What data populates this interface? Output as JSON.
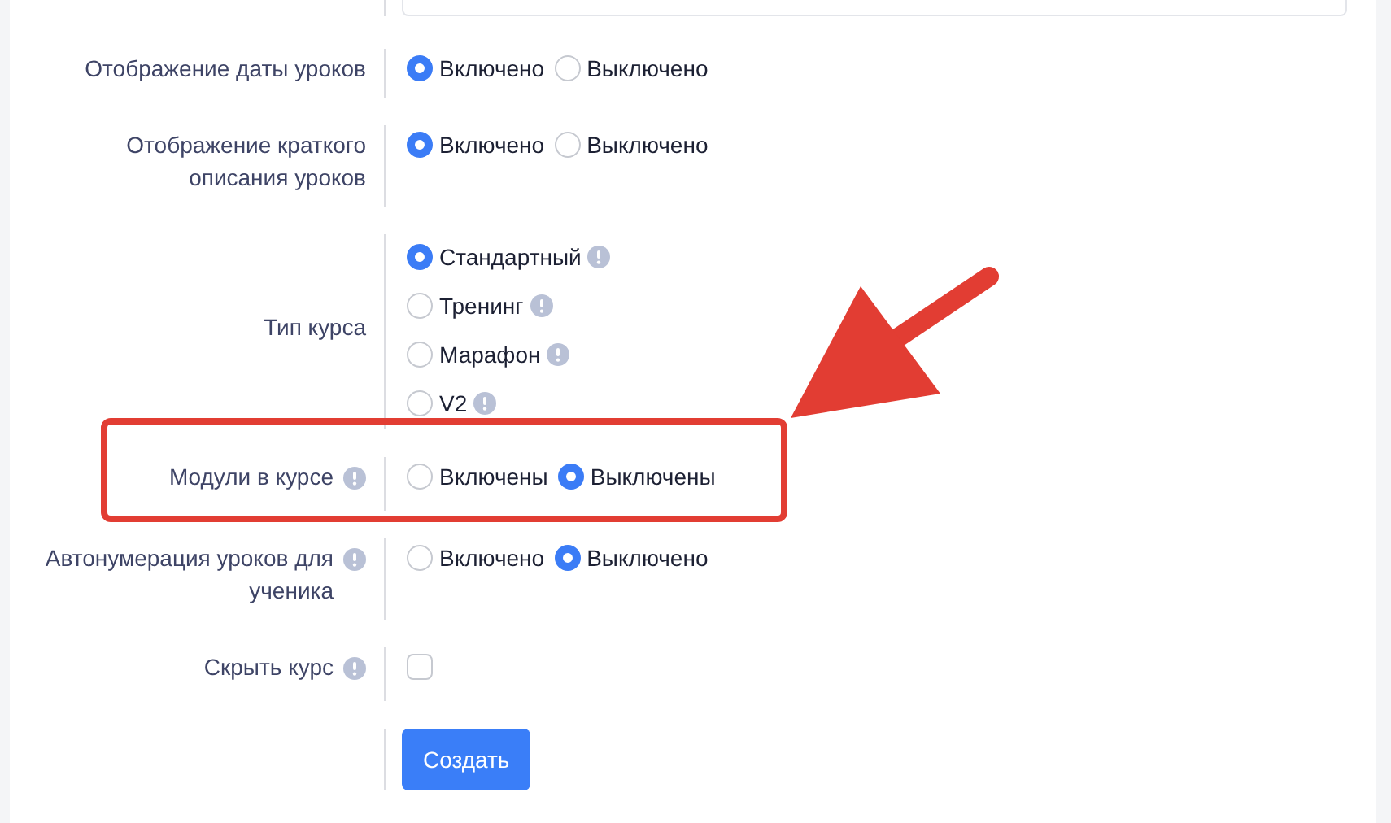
{
  "annotation": {
    "arrow": true
  },
  "rows": [
    {
      "kind": "field"
    },
    {
      "kind": "radio-inline",
      "label": "Отображение даты уроков",
      "hint": false,
      "options": [
        {
          "label": "Включено",
          "selected": true
        },
        {
          "label": "Выключено",
          "selected": false
        }
      ]
    },
    {
      "kind": "radio-inline",
      "label": "Отображение краткого описания уроков",
      "hint": false,
      "options": [
        {
          "label": "Включено",
          "selected": true
        },
        {
          "label": "Выключено",
          "selected": false
        }
      ]
    },
    {
      "kind": "radio-stacked",
      "label": "Тип курса",
      "hint": false,
      "options": [
        {
          "label": "Стандартный",
          "selected": true,
          "hint": true
        },
        {
          "label": "Тренинг",
          "selected": false,
          "hint": true
        },
        {
          "label": "Марафон",
          "selected": false,
          "hint": true
        },
        {
          "label": "V2",
          "selected": false,
          "hint": true
        }
      ]
    },
    {
      "kind": "radio-inline",
      "label": "Модули в курсе",
      "hint": true,
      "highlighted": true,
      "options": [
        {
          "label": "Включены",
          "selected": false
        },
        {
          "label": "Выключены",
          "selected": true
        }
      ]
    },
    {
      "kind": "radio-inline",
      "label": "Автонумерация уроков для ученика",
      "hint": true,
      "options": [
        {
          "label": "Включено",
          "selected": false
        },
        {
          "label": "Выключено",
          "selected": true
        }
      ]
    },
    {
      "kind": "checkbox",
      "label": "Скрыть курс",
      "hint": true,
      "checked": false
    },
    {
      "kind": "button",
      "text": "Создать"
    }
  ]
}
